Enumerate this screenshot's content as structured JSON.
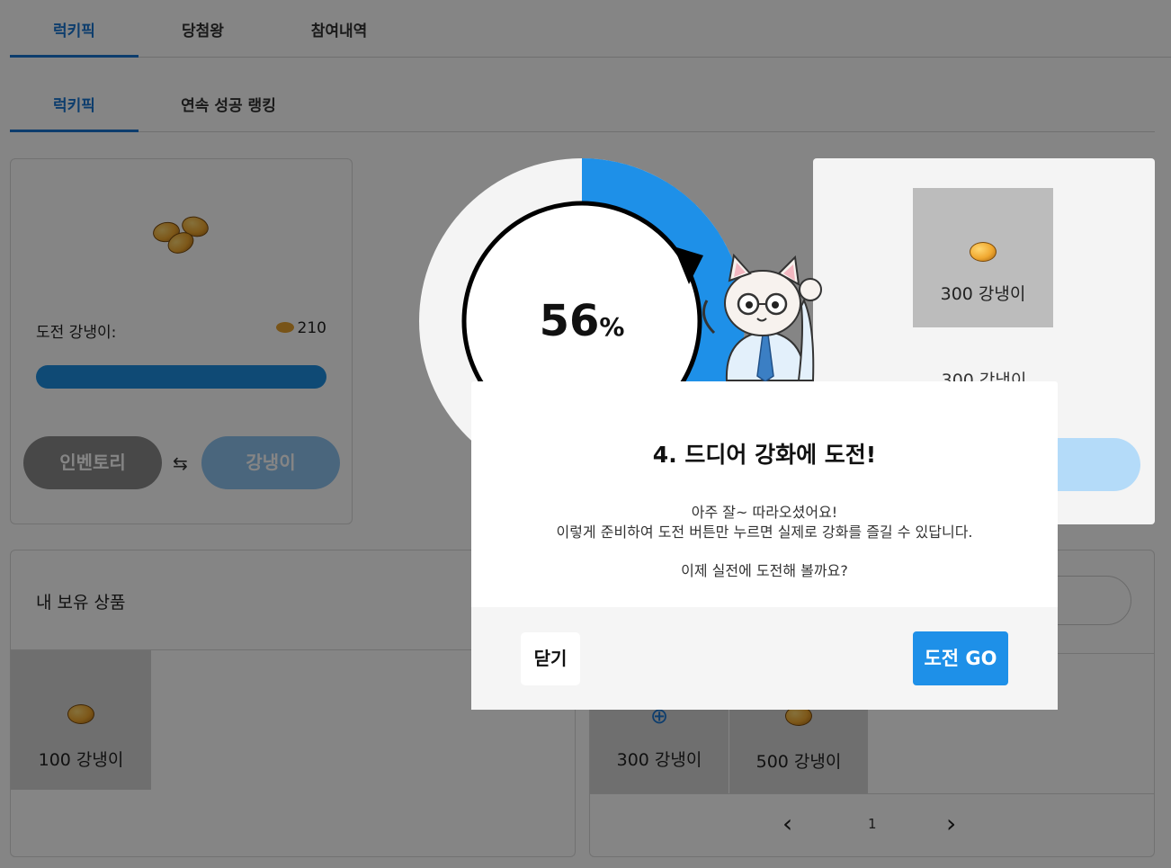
{
  "tabs_top": [
    "럭키픽",
    "당첨왕",
    "참여내역"
  ],
  "tabs_sub": [
    "럭키픽",
    "연속 성공 랭킹"
  ],
  "left_card": {
    "challenge_label": "도전 강냉이:",
    "challenge_value": "210",
    "swap_icon": "⇆",
    "inventory_button": "인벤토리",
    "popcorn_button": "강냉이"
  },
  "dial": {
    "percent": "56",
    "percent_sign": "%",
    "progress_fraction": 0.56
  },
  "right_card": {
    "product_label": "300 강냉이",
    "product_label_2": "300 강냉이"
  },
  "my_products": {
    "title": "내 보유 상품",
    "items": [
      {
        "label": "100 강냉이"
      }
    ]
  },
  "shop": {
    "items": [
      {
        "label": "300 강냉이"
      },
      {
        "label": "500 강냉이"
      }
    ],
    "pagination": {
      "prev": "‹",
      "page": "1",
      "next": "›"
    }
  },
  "modal": {
    "title": "4. 드디어 강화에 도전!",
    "line1": "아주 잘~ 따라오셨어요!",
    "line2": "이렇게 준비하여 도전 버튼만 누르면 실제로 강화를 즐길 수 있답니다.",
    "line3": "이제 실전에 도전해 볼까요?",
    "close_button": "닫기",
    "go_button": "도전 GO"
  },
  "colors": {
    "accent": "#1e90e8",
    "tab_active": "#1976d2"
  }
}
